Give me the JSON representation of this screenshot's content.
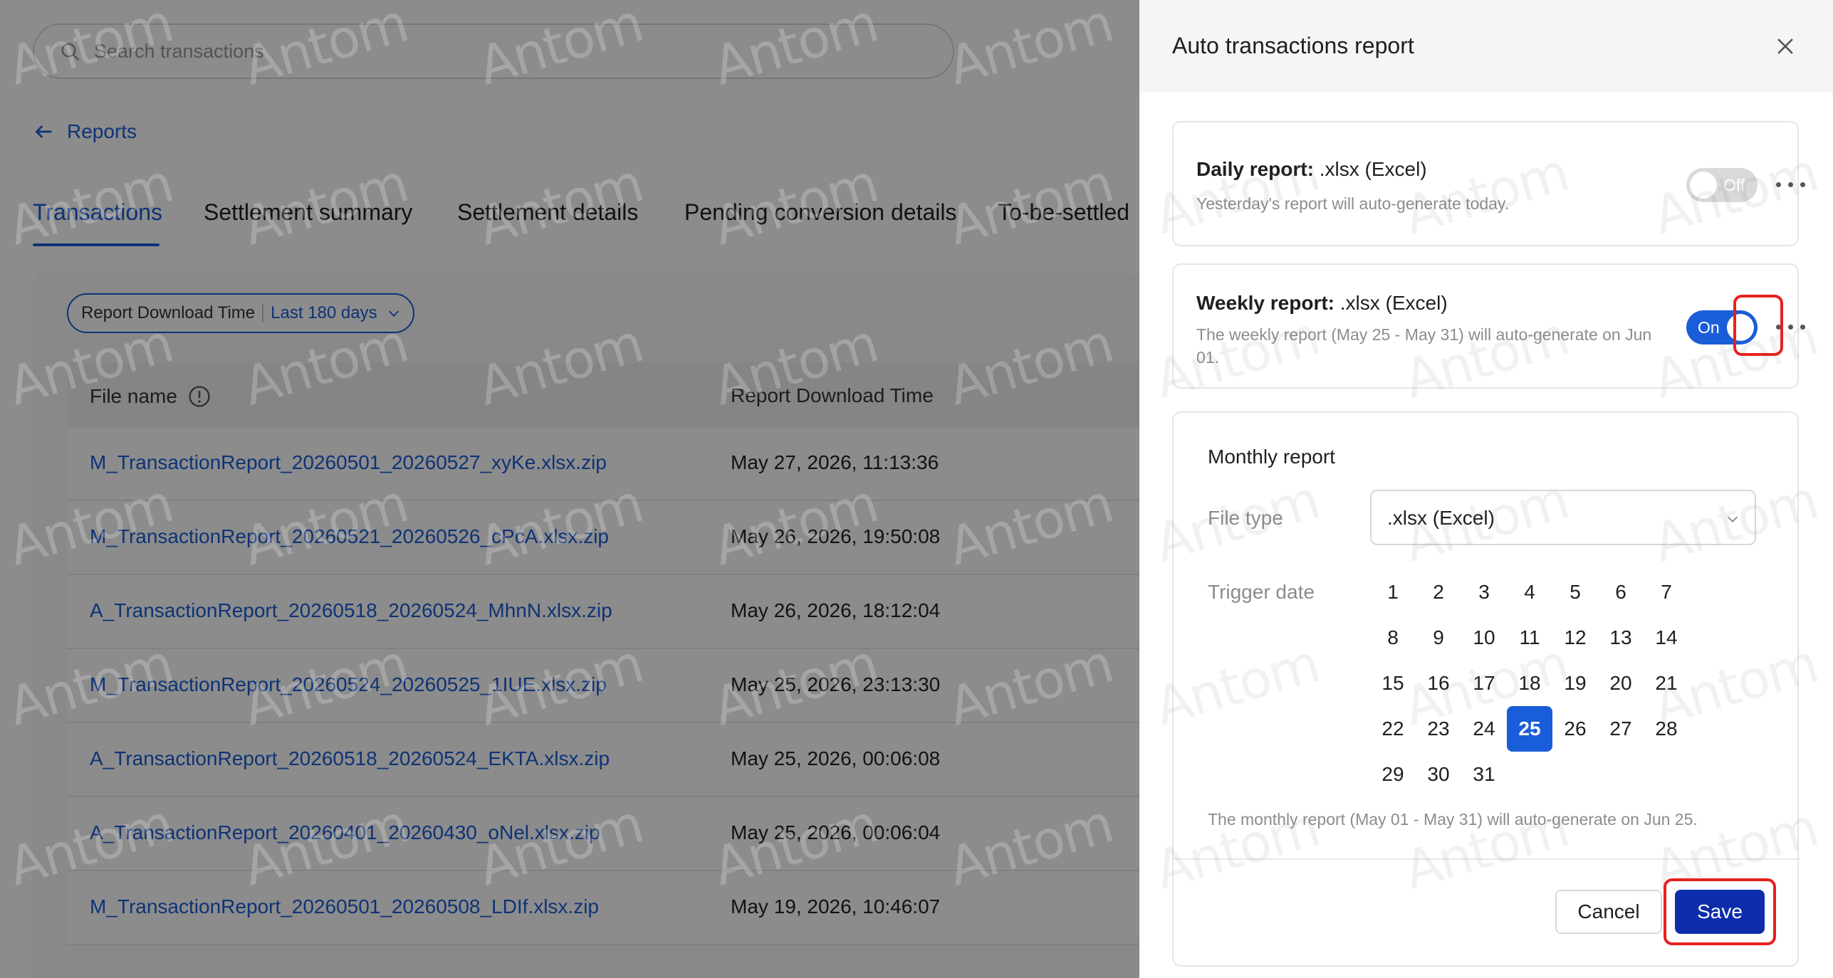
{
  "search": {
    "placeholder": "Search transactions"
  },
  "back_link": "Reports",
  "tabs": [
    "Transactions",
    "Settlement summary",
    "Settlement details",
    "Pending conversion details",
    "To-be-settled"
  ],
  "filter": {
    "label": "Report Download Time",
    "value": "Last 180 days"
  },
  "table": {
    "columns": [
      "File name",
      "Report Download Time"
    ],
    "rows": [
      {
        "file": "M_TransactionReport_20260501_20260527_xyKe.xlsx.zip",
        "time": "May 27, 2026, 11:13:36"
      },
      {
        "file": "M_TransactionReport_20260521_20260526_cPcA.xlsx.zip",
        "time": "May 26, 2026, 19:50:08"
      },
      {
        "file": "A_TransactionReport_20260518_20260524_MhnN.xlsx.zip",
        "time": "May 26, 2026, 18:12:04"
      },
      {
        "file": "M_TransactionReport_20260524_20260525_1IUE.xlsx.zip",
        "time": "May 25, 2026, 23:13:30"
      },
      {
        "file": "A_TransactionReport_20260518_20260524_EKTA.xlsx.zip",
        "time": "May 25, 2026, 00:06:08"
      },
      {
        "file": "A_TransactionReport_20260401_20260430_oNel.xlsx.zip",
        "time": "May 25, 2026, 00:06:04"
      },
      {
        "file": "M_TransactionReport_20260501_20260508_LDIf.xlsx.zip",
        "time": "May 19, 2026, 10:46:07"
      }
    ]
  },
  "drawer": {
    "title": "Auto transactions report",
    "daily": {
      "title_bold": "Daily report:",
      "title_rest": " .xlsx (Excel)",
      "desc": "Yesterday's report will auto-generate today.",
      "toggle": "Off"
    },
    "weekly": {
      "title_bold": "Weekly report:",
      "title_rest": " .xlsx (Excel)",
      "desc": "The weekly report (May 25 - May 31) will auto-generate on Jun 01.",
      "toggle": "On"
    },
    "monthly": {
      "title": "Monthly report",
      "file_type_label": "File type",
      "file_type_value": ".xlsx (Excel)",
      "trigger_label": "Trigger date",
      "selected_day": 25,
      "note": "The monthly report (May 01 - May 31) will auto-generate on Jun 25."
    },
    "cancel": "Cancel",
    "save": "Save"
  },
  "watermark": "Antom",
  "colors": {
    "accent": "#1a5dd8",
    "save": "#0d2dab",
    "highlight": "#e8201e"
  }
}
